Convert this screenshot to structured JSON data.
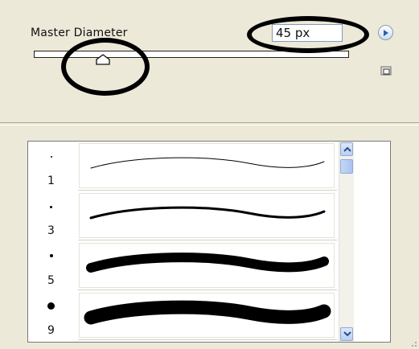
{
  "master_diameter": {
    "label": "Master Diameter",
    "value": "45 px",
    "slider_fraction": 0.22
  },
  "brushes": [
    {
      "size": "1",
      "stroke_weight": 1
    },
    {
      "size": "3",
      "stroke_weight": 3
    },
    {
      "size": "5",
      "stroke_weight": 12
    },
    {
      "size": "9",
      "stroke_weight": 17
    }
  ],
  "icons": {
    "menu": "flyout-menu-arrow-icon",
    "new_preset": "new-preset-icon",
    "scroll_up": "scroll-up-arrow-icon",
    "scroll_down": "scroll-down-arrow-icon"
  },
  "colors": {
    "panel_bg": "#ECE9D8",
    "annotation": "#000000",
    "scroll_accent": "#b9cff3"
  }
}
